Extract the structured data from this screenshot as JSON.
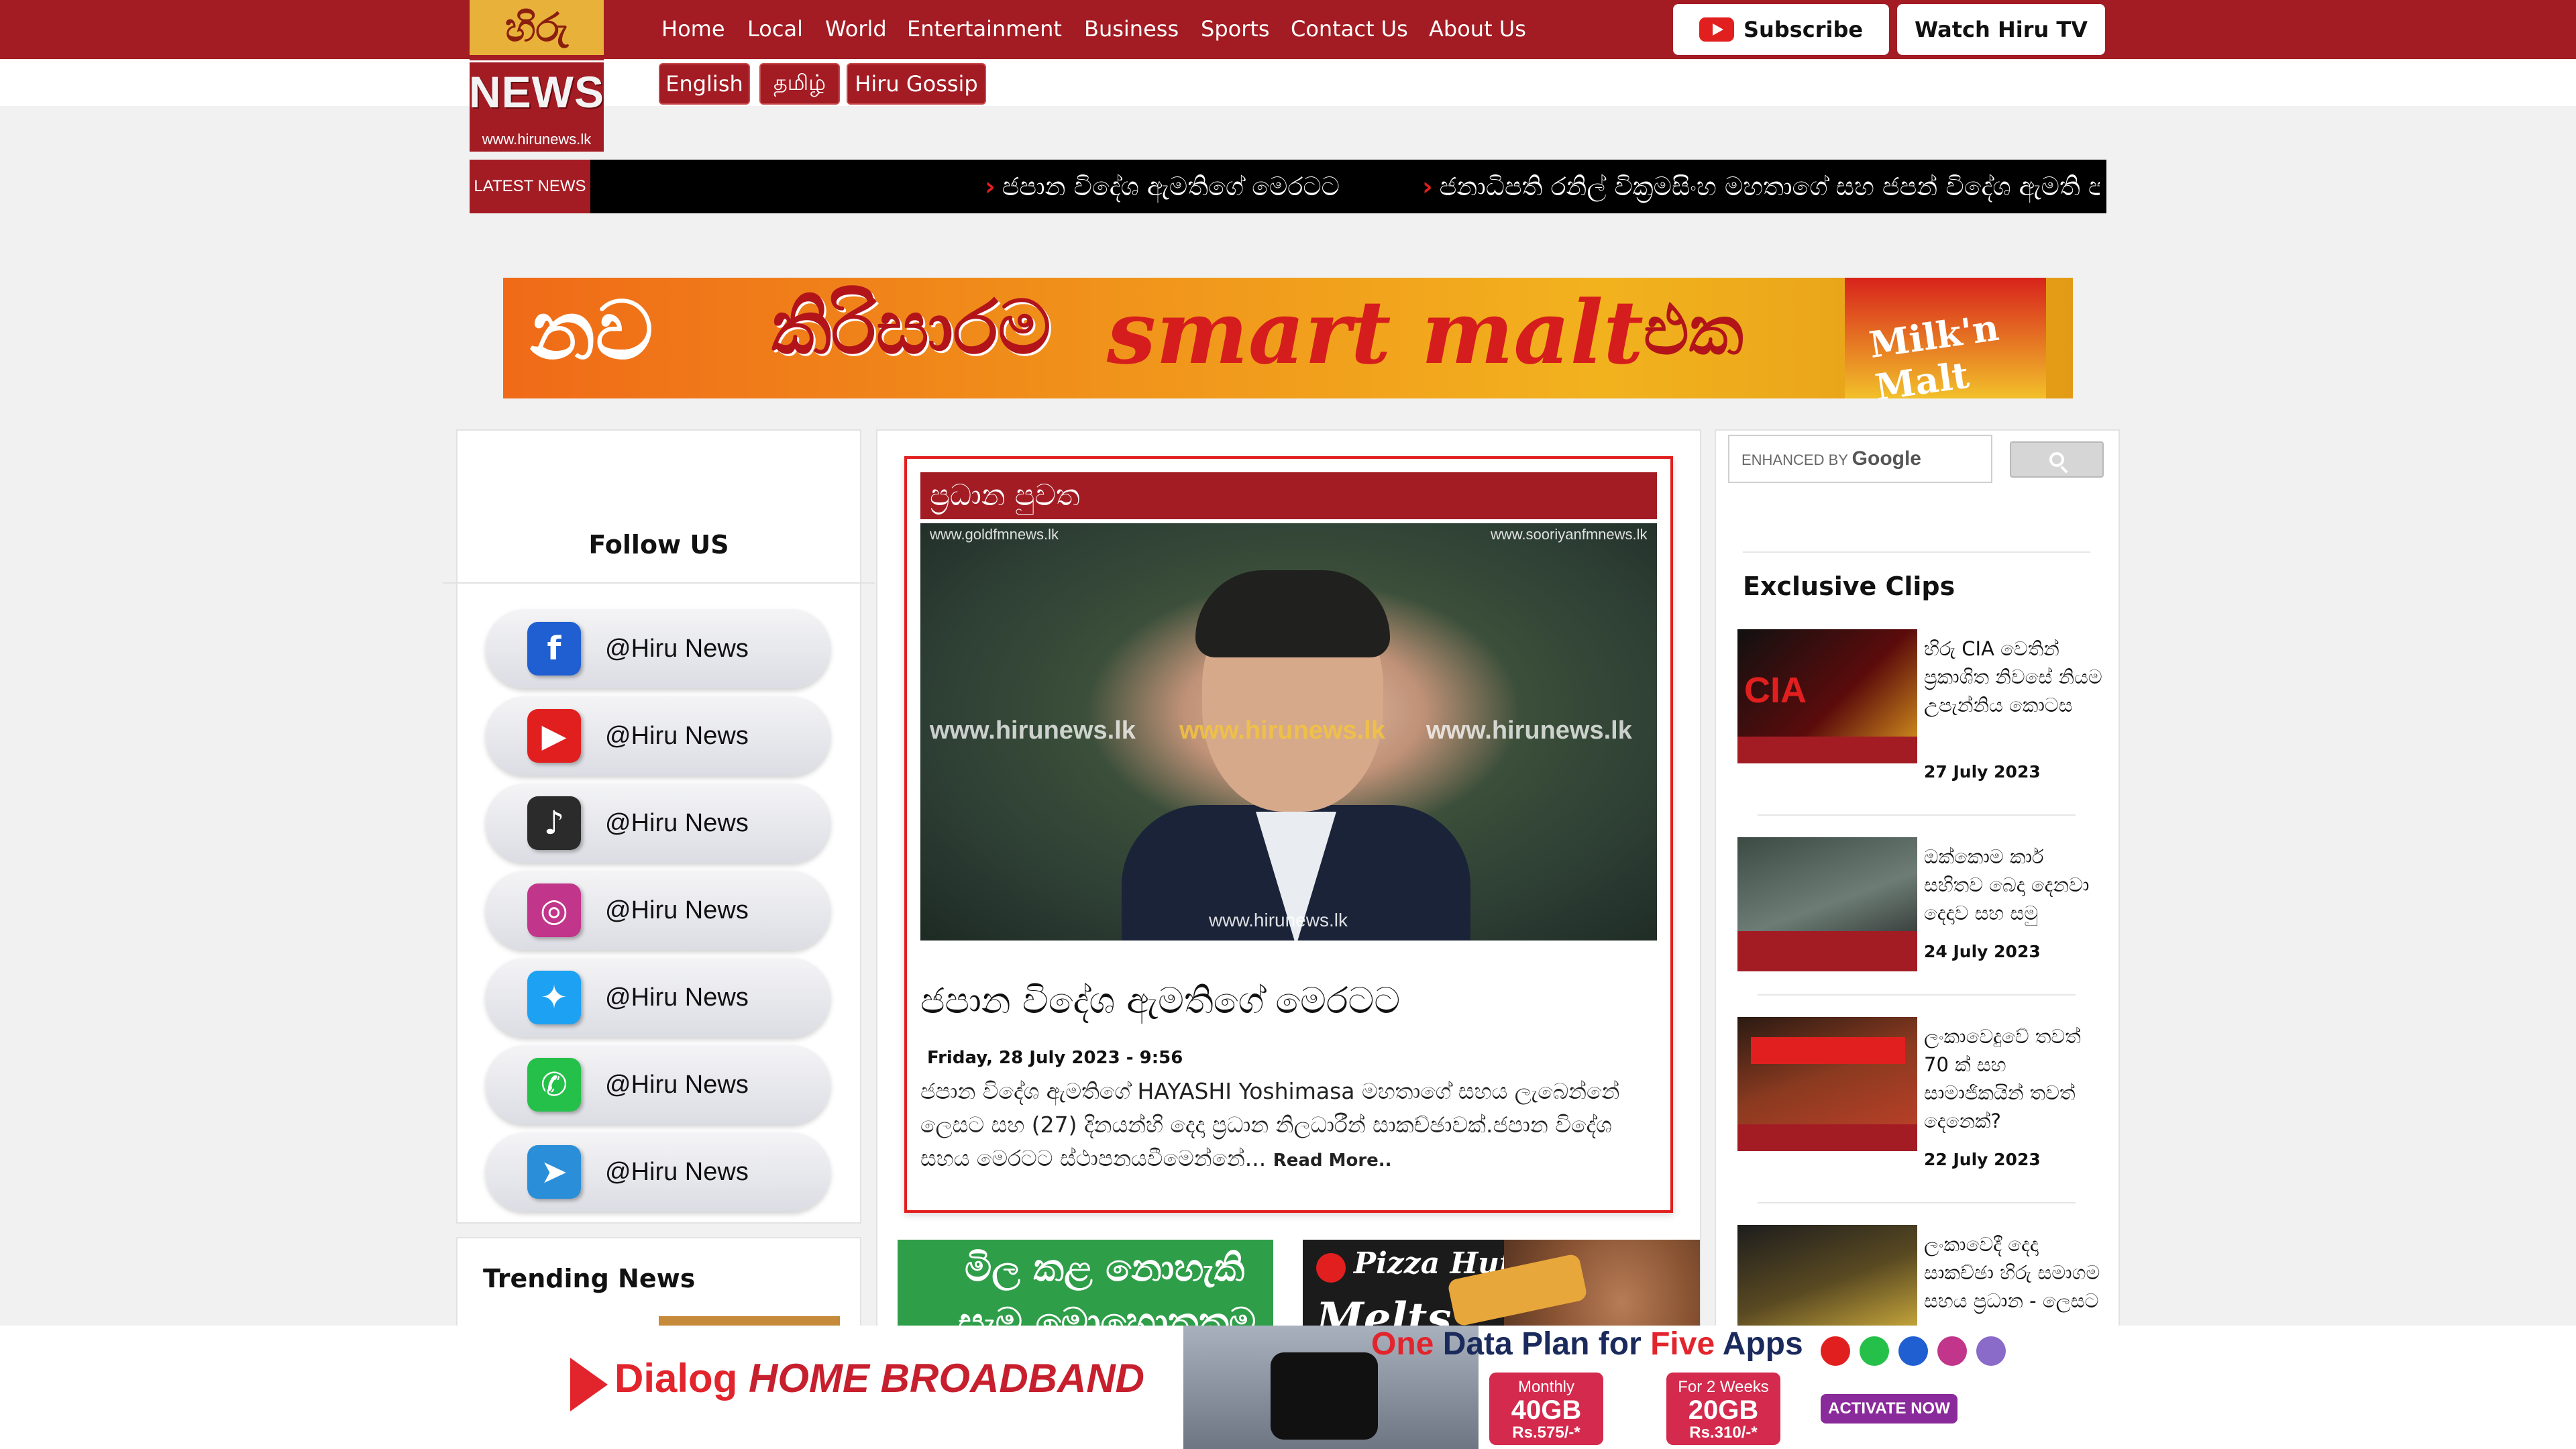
{
  "header": {
    "logo": {
      "top_text": "හිරු",
      "main_text": "NEWS",
      "url_text": "www.hirunews.lk"
    },
    "nav": [
      "Home",
      "Local",
      "World",
      "Entertainment",
      "Business",
      "Sports",
      "Contact Us",
      "About Us"
    ],
    "subscribe_label": "Subscribe",
    "watch_label": "Watch Hiru TV",
    "languages": [
      "English",
      "தமிழ்",
      "Hiru Gossip"
    ]
  },
  "ticker": {
    "label": "LATEST NEWS",
    "items": [
      "ජපාන විදේශ ඇමතිගේ මෙරටට",
      "ජනාධිපති රනිල් වික්‍රමසිංහ මහතාගේ සහ ජපන් විදේශ ඇමති ප"
    ]
  },
  "banner_ad": {
    "t1": "නව",
    "t2": "කිරිසාරම",
    "t3": "smart malt",
    "t4": "එක",
    "pack": "Milk'n Malt"
  },
  "left": {
    "follow_title": "Follow US",
    "socials": [
      {
        "icon": "facebook-icon",
        "label": "@Hiru News",
        "color": "#1f5fd1"
      },
      {
        "icon": "youtube-icon",
        "label": "@Hiru News",
        "color": "#e21f1f"
      },
      {
        "icon": "tiktok-icon",
        "label": "@Hiru News",
        "color": "#2b2b2b"
      },
      {
        "icon": "instagram-icon",
        "label": "@Hiru News",
        "color": "#c1358a"
      },
      {
        "icon": "twitter-icon",
        "label": "@Hiru News",
        "color": "#1da1f2"
      },
      {
        "icon": "whatsapp-icon",
        "label": "@Hiru News",
        "color": "#25c04a"
      },
      {
        "icon": "telegram-icon",
        "label": "@Hiru News",
        "color": "#2a8fd8"
      }
    ],
    "trending_title": "Trending News"
  },
  "main": {
    "section_title": "ප්‍රධාන පුවත",
    "watermarks": [
      "www.goldfmnews.lk",
      "www.sooriyanfmnews.lk",
      "www.hirunews.lk",
      "www.hirunews.lk",
      "www.hirunews.lk",
      "www.hirunews.lk"
    ],
    "title": "ජපාන විදේශ ඇමතිගේ මෙරටට",
    "date": "Friday, 28 July 2023 - 9:56",
    "body": "ජපාන විදේශ ඇමතිගේ HAYASHI Yoshimasa මහතාගේ සහය ලැබෙන්නේ ලෙසට සහ (27) දිනයන්හි දෙදා ප්‍රධාන නිලධාරීන් සාකච්ඡාවක්.ජපාන විදේශ සහය මෙරටට ස්ථාපනයවීමෙන්නේ...",
    "read_more": "Read More.."
  },
  "right": {
    "search_placeholder_small": "ENHANCED BY",
    "search_placeholder_brand": "Google",
    "exclusive_title": "Exclusive Clips",
    "clips": [
      {
        "title": "හිරු CIA වෙතින් ප්‍රකාශිත නිවසේ නියම උපැන්නිය කොටස",
        "date": "27 July 2023"
      },
      {
        "title": "ඔක්කොම කාර් සහිතව බෙදා දෙනවා දෙදාව සහ සමු",
        "date": "24 July 2023"
      },
      {
        "title": "ලංකාවෙදුවේ තවත් 70 ක් සහ සාමාජිකයින් තවත් දෙනෙක්?",
        "date": "22 July 2023"
      },
      {
        "title": "ලංකාවෙදී දෙදා සාකච්ඡා හිරු සමාගම සහය ප්‍රධාන - ලෙසට",
        "date": ""
      }
    ]
  },
  "bottom_ad": {
    "brand": "Dialog",
    "product": "HOME BROADBAND",
    "headline_a": "One",
    "headline_b": " Data Plan for ",
    "headline_c": "Five",
    "headline_d": " Apps",
    "plan1": {
      "top": "Monthly",
      "size": "40GB",
      "price": "Rs.575/-*"
    },
    "plan2": {
      "top": "For 2 Weeks",
      "size": "20GB",
      "price": "Rs.310/-*"
    },
    "activate": "ACTIVATE NOW"
  },
  "colors": {
    "brand_red": "#a31c24",
    "accent_red": "#e21f1f"
  }
}
